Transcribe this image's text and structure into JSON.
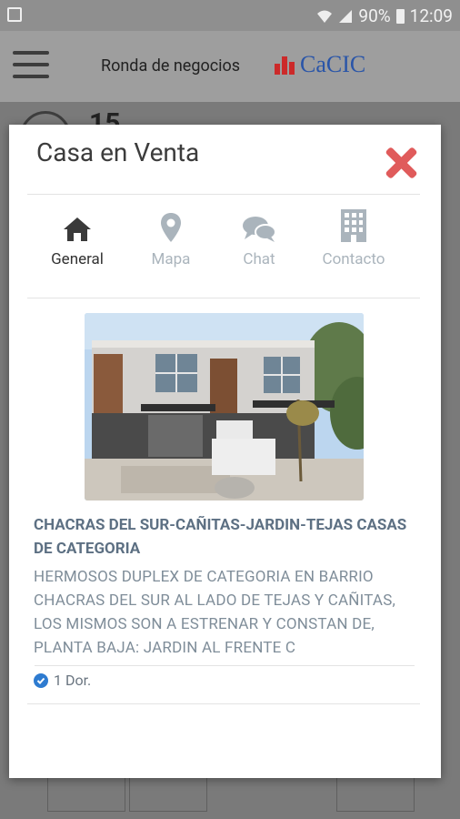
{
  "status_bar": {
    "battery": "90%",
    "time": "12:09"
  },
  "app_bar": {
    "title": "Ronda de negocios",
    "logo_text": "CaCIC",
    "logo_color": "#2a55a8",
    "logo_mark_color": "#cc2a2a"
  },
  "background": {
    "number": "15"
  },
  "modal": {
    "title": "Casa en Venta",
    "tabs": [
      {
        "label": "General",
        "icon": "home-icon",
        "active": true
      },
      {
        "label": "Mapa",
        "icon": "map-marker-icon",
        "active": false
      },
      {
        "label": "Chat",
        "icon": "chat-bubbles-icon",
        "active": false
      },
      {
        "label": "Contacto",
        "icon": "building-icon",
        "active": false
      }
    ],
    "listing": {
      "title": "CHACRAS DEL SUR-CAÑITAS-JARDIN-TEJAS CASAS DE CATEGORIA",
      "description": "HERMOSOS DUPLEX DE CATEGORIA EN BARRIO CHACRAS DEL SUR AL LADO DE TEJAS Y CAÑITAS, LOS MISMOS SON A ESTRENAR Y CONSTAN DE, PLANTA BAJA: JARDIN AL FRENTE C",
      "features": [
        {
          "label": "1 Dor.",
          "icon": "check-circle-icon"
        }
      ]
    }
  },
  "colors": {
    "close": "#e05b5b",
    "accent": "#2e7bd0",
    "title_text": "#5d7083"
  }
}
